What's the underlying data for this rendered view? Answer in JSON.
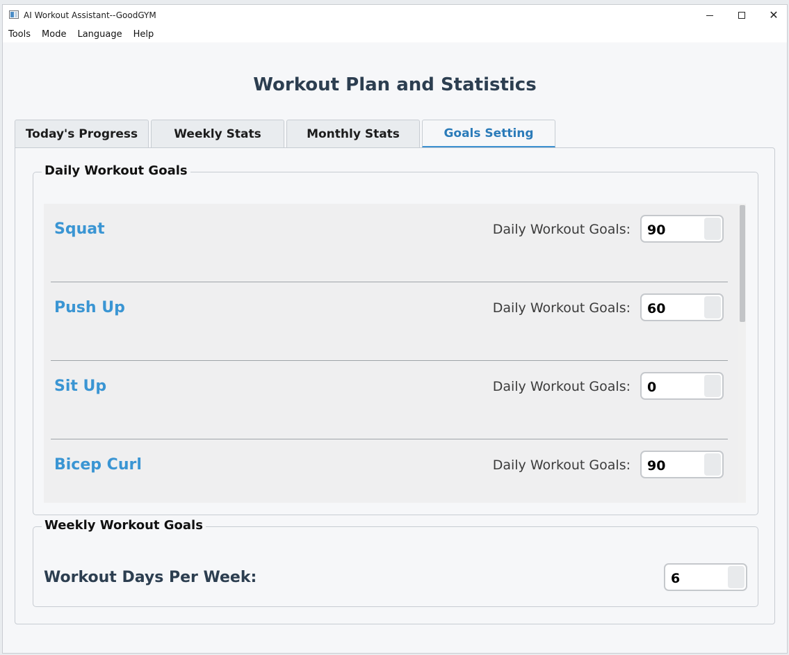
{
  "window": {
    "title": "AI Workout Assistant--GoodGYM"
  },
  "menu": [
    "Tools",
    "Mode",
    "Language",
    "Help"
  ],
  "page_title": "Workout Plan and Statistics",
  "tabs": [
    {
      "label": "Today's Progress",
      "active": false
    },
    {
      "label": "Weekly Stats",
      "active": false
    },
    {
      "label": "Monthly Stats",
      "active": false
    },
    {
      "label": "Goals Setting",
      "active": true
    }
  ],
  "daily_goals": {
    "legend": "Daily Workout Goals",
    "field_label": "Daily Workout Goals:",
    "items": [
      {
        "name": "Squat",
        "value": "90"
      },
      {
        "name": "Push Up",
        "value": "60"
      },
      {
        "name": "Sit Up",
        "value": "0"
      },
      {
        "name": "Bicep Curl",
        "value": "90"
      }
    ]
  },
  "weekly_goals": {
    "legend": "Weekly Workout Goals",
    "label": "Workout Days Per Week:",
    "value": "6"
  },
  "colors": {
    "accent": "#3a95d3",
    "title": "#2c3e50",
    "active_tab": "#2b7bb9"
  }
}
